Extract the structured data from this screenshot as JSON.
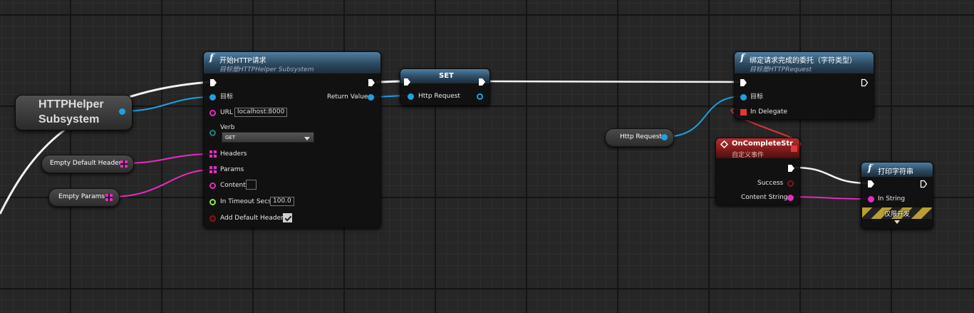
{
  "graph": {
    "httphelper_var": {
      "label": "HTTPHelper Subsystem"
    },
    "empty_headers_var": {
      "label": "Empty Default Headers"
    },
    "empty_params_var": {
      "label": "Empty Params"
    },
    "http_request_var": {
      "label": "Http Request"
    },
    "start_http_node": {
      "icon": "function-f-icon",
      "title": "开始HTTP请求",
      "subtitle": "目标是HTTPHelper Subsystem",
      "target_label": "目标",
      "url_label": "URL",
      "url_value": "localhost:8000",
      "verb_label": "Verb",
      "verb_value": "GET",
      "headers_label": "Headers",
      "params_label": "Params",
      "content_label": "Content",
      "timeout_label": "In Timeout Secs",
      "timeout_value": "100.0",
      "add_default_headers_label": "Add Default Headers",
      "add_default_headers_checked": true,
      "return_value_label": "Return Value"
    },
    "set_node": {
      "title": "SET",
      "http_request_label": "Http Request"
    },
    "bind_node": {
      "icon": "function-f-icon",
      "title": "绑定请求完成的委托（字符类型）",
      "subtitle": "目标是HTTPRequest",
      "target_label": "目标",
      "delegate_label": "In Delegate"
    },
    "event_node": {
      "icon": "event-diamond-icon",
      "title": "OnCompleteStr",
      "subtitle": "自定义事件",
      "success_label": "Success",
      "content_string_label": "Content String"
    },
    "print_node": {
      "icon": "function-f-icon",
      "title": "打印字符串",
      "in_string_label": "In String",
      "dev_only_label": "仅限开发"
    }
  },
  "colors": {
    "exec": "#ffffff",
    "object": "#1fa0e0",
    "string": "#e62cbd",
    "bool": "#8c1414",
    "float": "#8ee54a",
    "delegate": "#e33636",
    "struct": "#1e8080"
  }
}
